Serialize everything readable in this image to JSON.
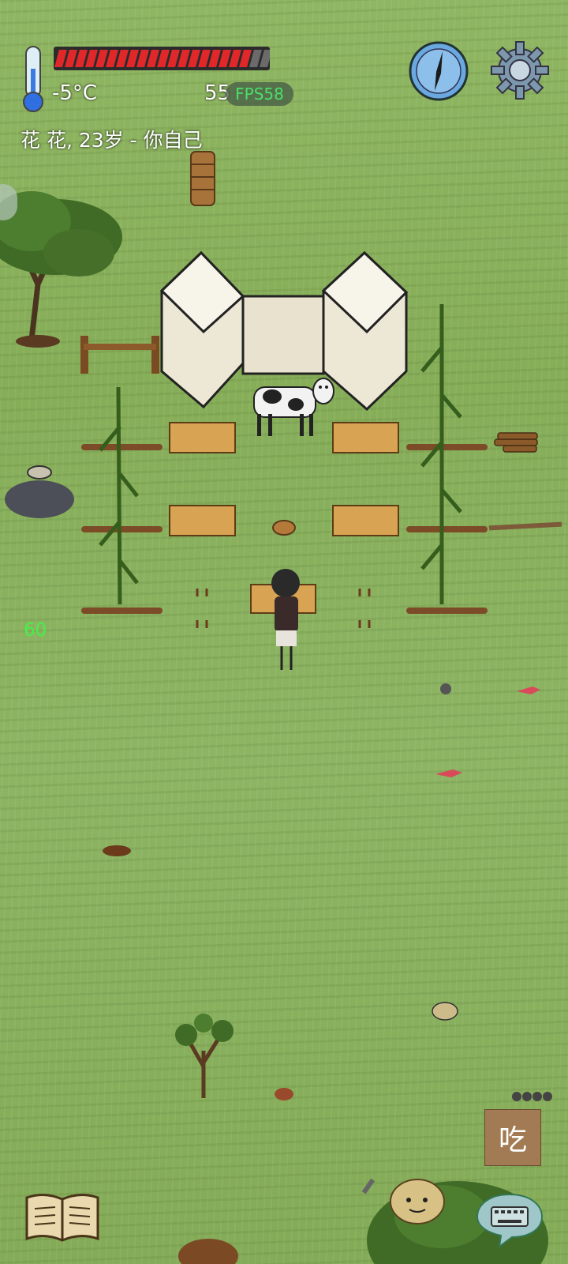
{
  "hud": {
    "temperature": "-5°C",
    "health_fraction": 0.88,
    "fps_value": "55",
    "fps_label": "FPS58",
    "player_label": "花 花, 23岁 - 你自己",
    "side_counter": "60"
  },
  "controls": {
    "eat_label": "吃"
  },
  "colors": {
    "grass": "#8cb463",
    "health_red": "#e0282a",
    "fps_green": "#49e06a",
    "eat_button": "#a27a53"
  }
}
